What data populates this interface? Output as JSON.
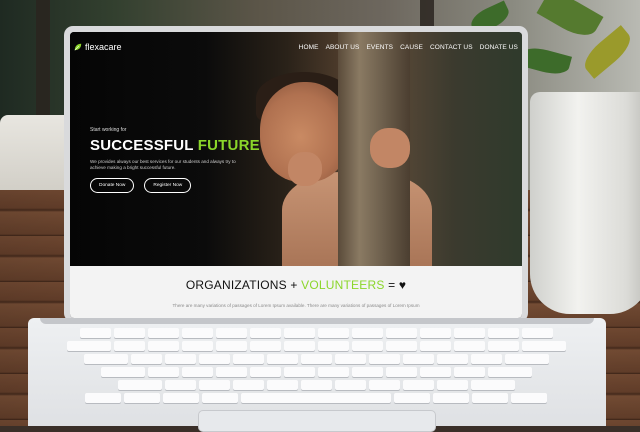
{
  "site": {
    "logo_text": "flexacare",
    "nav": [
      "HOME",
      "ABOUT US",
      "EVENTS",
      "CAUSE",
      "CONTACT US",
      "DONATE US"
    ],
    "hero": {
      "eyebrow": "Start working for",
      "headline_main": "SUCCESSFUL",
      "headline_accent": "FUTURE",
      "description": "We provides always our best services for our students and always try to achieve making a bright successful future.",
      "button_donate": "Donate Now",
      "button_register": "Register Now"
    },
    "section": {
      "title_part1": "ORGANIZATIONS +",
      "title_accent": "VOLUNTEERS",
      "title_part2": "=",
      "heart": "♥",
      "subtitle": "There are many variations of passages of Lorem Ipsum available. There are many variations of passages of Lorem Ipsum"
    }
  },
  "colors": {
    "accent": "#8bd62a",
    "hero_bg": "#050505",
    "section_bg": "#f3f3f3"
  },
  "icons": {
    "logo": "leaf-icon",
    "heart": "heart-icon"
  }
}
